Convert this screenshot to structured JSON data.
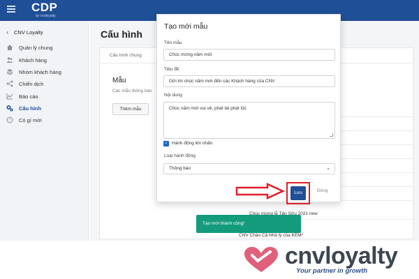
{
  "header": {
    "logo": "CDP",
    "logo_sub": "by cnvloyalty"
  },
  "sidebar": {
    "back_label": "CNV Loyalty",
    "items": [
      {
        "label": "Quản lý chung",
        "icon": "home-icon"
      },
      {
        "label": "Khách hàng",
        "icon": "users-icon"
      },
      {
        "label": "Nhóm khách hàng",
        "icon": "layers-icon"
      },
      {
        "label": "Chiến dịch",
        "icon": "share-icon"
      },
      {
        "label": "Báo cáo",
        "icon": "chart-icon"
      },
      {
        "label": "Cấu hình",
        "icon": "gears-icon",
        "active": true
      },
      {
        "label": "Có gì mới",
        "icon": "question-icon"
      }
    ]
  },
  "main": {
    "title": "Cấu hình",
    "tab": "Cấu hình chung",
    "section_title": "Mẫu",
    "section_desc": "Các mẫu thông báo",
    "add_button": "Thêm mẫu",
    "list_items": [
      "Chúc mừng lễ Tân Sửu 2021 new",
      "CNV Chào Cả Nhà lỳ của KEM!"
    ]
  },
  "modal": {
    "title": "Tạo mới mẫu",
    "name_label": "Tên mẫu",
    "name_value": "Chúc mừng năm mới",
    "subject_label": "Tiêu đề",
    "subject_value": "Gửi lời chúc năm mới đến các Khách hàng của CNV",
    "content_label": "Nội dung",
    "content_value": "Chúc năm mới vui vẻ, phát tài phát lộc",
    "checkbox_label": "Hành động khi nhấn",
    "checkbox_checked": true,
    "action_type_label": "Loại hành động",
    "action_type_value": "Thông báo",
    "save_label": "Lưu",
    "close_label": "Đóng"
  },
  "toast": {
    "message": "Tạo mới thành công!"
  },
  "branding": {
    "name": "cnvloyalty",
    "tagline": "Your partner in growth"
  },
  "colors": {
    "primary": "#1f4f96",
    "highlight": "#e11d2a",
    "toast": "#149b7c",
    "brand_pink": "#e0607a"
  }
}
